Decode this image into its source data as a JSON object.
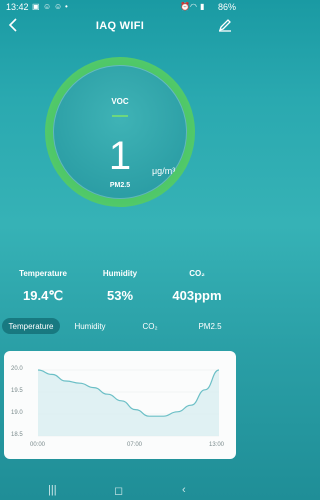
{
  "status_bar": {
    "time": "13:42",
    "icons_left": [
      "photo-icon",
      "face-icon",
      "face-icon",
      "dot-icon"
    ],
    "battery": "86%"
  },
  "header": {
    "title": "IAQ WIFI"
  },
  "gauge": {
    "label_top": "VOC",
    "value": "1",
    "unit": "μg/m³",
    "label_bottom": "PM2.5",
    "ring_color": "#4cc766"
  },
  "metrics": [
    {
      "label": "Temperature",
      "value": "19.4℃"
    },
    {
      "label": "Humidity",
      "value": "53%"
    },
    {
      "label": "CO₂",
      "value": "403ppm"
    }
  ],
  "tabs": [
    "Temperature",
    "Humidity",
    "CO₂",
    "PM2.5"
  ],
  "active_tab": "Temperature",
  "chart_data": {
    "type": "area",
    "x": [
      "00:00",
      "01:00",
      "02:00",
      "03:00",
      "04:00",
      "05:00",
      "06:00",
      "07:00",
      "08:00",
      "09:00",
      "10:00",
      "11:00",
      "12:00",
      "13:00"
    ],
    "values": [
      20.0,
      19.9,
      19.75,
      19.7,
      19.6,
      19.45,
      19.3,
      19.1,
      18.95,
      18.95,
      19.05,
      19.2,
      19.55,
      20.0
    ],
    "ylim": [
      18.5,
      20.0
    ],
    "yticks": [
      "20.0",
      "19.5",
      "19.0",
      "18.5"
    ],
    "xticks": [
      "00:00",
      "07:00",
      "13:00"
    ],
    "line_color": "#6bbfc6",
    "fill_color": "#d9eef0"
  }
}
